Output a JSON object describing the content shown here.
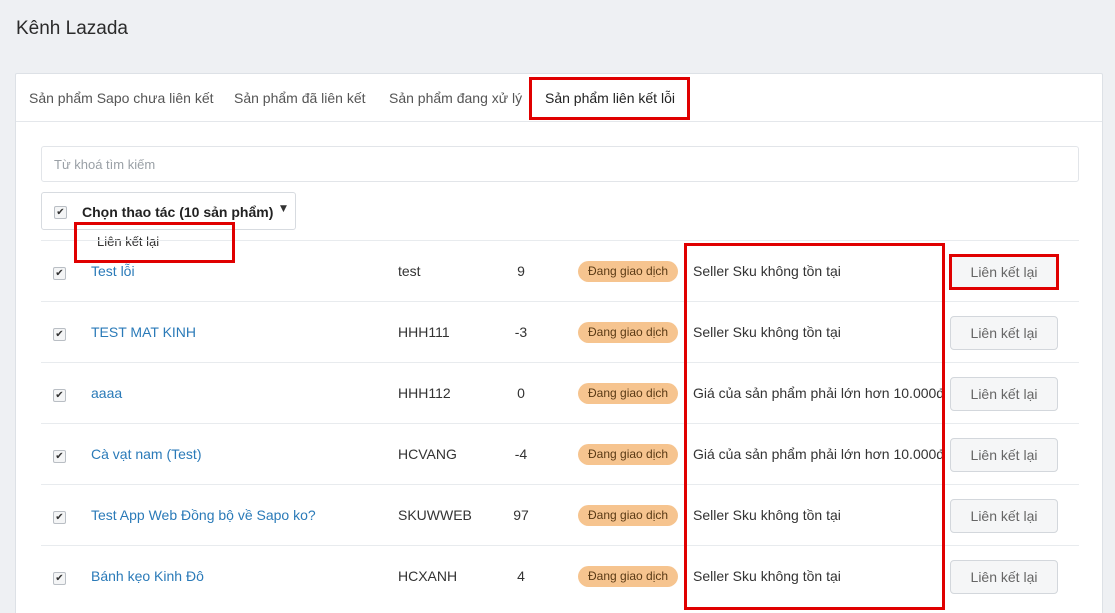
{
  "page": {
    "title": "Kênh Lazada"
  },
  "tabs": [
    {
      "label": "Sản phẩm Sapo chưa liên kết"
    },
    {
      "label": "Sản phẩm đã liên kết"
    },
    {
      "label": "Sản phẩm đang xử lý"
    },
    {
      "label": "Sản phẩm liên kết lỗi",
      "active": true
    }
  ],
  "search": {
    "placeholder": "Từ khoá tìm kiếm",
    "value": ""
  },
  "bulk_actions": {
    "label": "Chọn thao tác (10 sản phẩm)",
    "checked": true,
    "menu_items": [
      {
        "label": "Liên kết lại"
      }
    ]
  },
  "products": [
    {
      "name": "Test lỗi",
      "sku": "test",
      "qty": "9",
      "status": "Đang giao dịch",
      "error": "Seller Sku không tồn tại",
      "action": "Liên kết lại",
      "checked": true
    },
    {
      "name": "TEST MAT KINH",
      "sku": "HHH111",
      "qty": "-3",
      "status": "Đang giao dịch",
      "error": "Seller Sku không tồn tại",
      "action": "Liên kết lại",
      "checked": true
    },
    {
      "name": "aaaa",
      "sku": "HHH112",
      "qty": "0",
      "status": "Đang giao dịch",
      "error": "Giá của sản phẩm phải lớn hơn 10.000đ",
      "action": "Liên kết lại",
      "checked": true
    },
    {
      "name": "Cà vạt nam (Test)",
      "sku": "HCVANG",
      "qty": "-4",
      "status": "Đang giao dịch",
      "error": "Giá của sản phẩm phải lớn hơn 10.000đ",
      "action": "Liên kết lại",
      "checked": true
    },
    {
      "name": "Test App Web Đồng bộ về Sapo ko?",
      "sku": "SKUWWEB",
      "qty": "97",
      "status": "Đang giao dịch",
      "error": "Seller Sku không tồn tại",
      "action": "Liên kết lại",
      "checked": true
    },
    {
      "name": "Bánh kẹo Kinh Đô",
      "sku": "HCXANH",
      "qty": "4",
      "status": "Đang giao dịch",
      "error": "Seller Sku không tồn tại",
      "action": "Liên kết lại",
      "checked": true
    }
  ],
  "icons": {
    "checkbox": "checkmark-icon",
    "dropdown": "caret-down-icon"
  },
  "colors": {
    "highlight": "#e00000",
    "link": "#2a7ab8",
    "badge": "#f6c48f"
  }
}
